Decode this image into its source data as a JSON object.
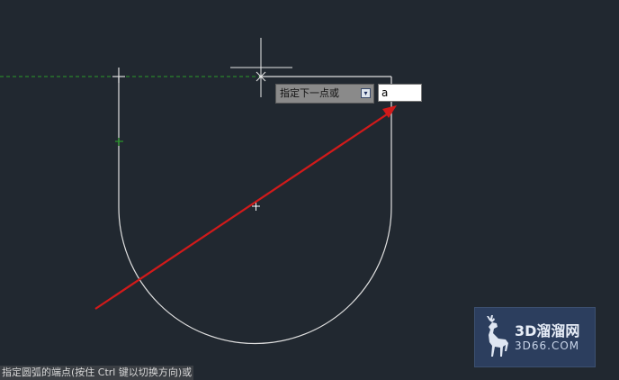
{
  "app": {
    "background": "#212830",
    "geometry_color": "#e0e0e0",
    "tracking_color": "#2a9a2a",
    "annotation_arrow_color": "#d11a1a"
  },
  "tooltip": {
    "prompt_label": "指定下一点或",
    "dropdown_icon": "arrow-down-icon"
  },
  "command_input": {
    "value": "a"
  },
  "status": {
    "prompt_text": "指定圆弧的端点(按住 Ctrl 键以切换方向)或"
  },
  "watermark": {
    "title": "3D溜溜网",
    "subtitle": "3D66.COM",
    "logo_icon": "deer-icon"
  }
}
